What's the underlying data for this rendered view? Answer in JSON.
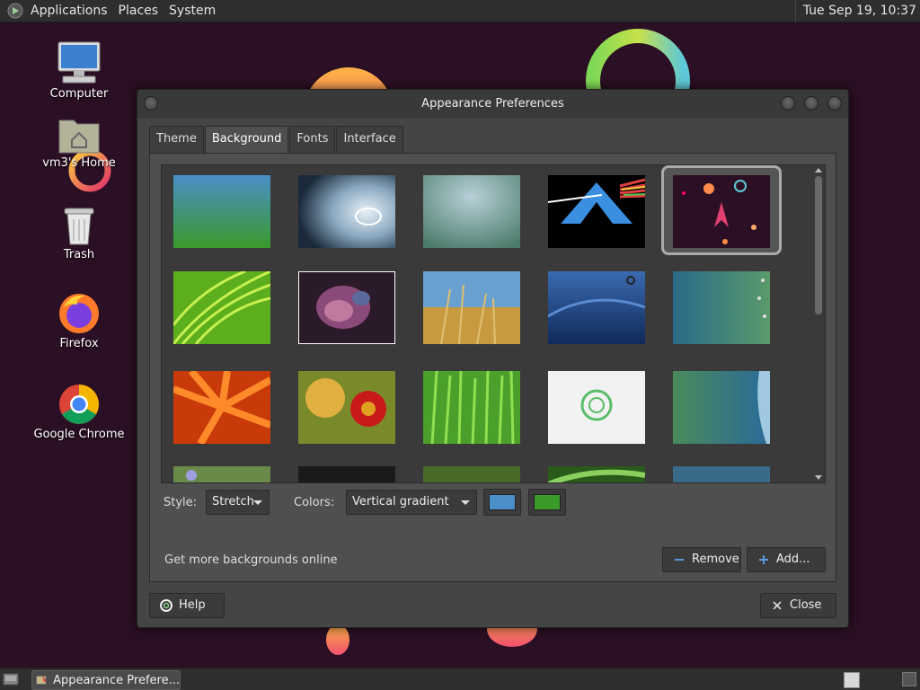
{
  "top_panel": {
    "menus": [
      "Applications",
      "Places",
      "System"
    ],
    "clock": "Tue Sep 19, 10:37"
  },
  "desktop_icons": [
    {
      "label": "Computer",
      "icon": "computer-icon"
    },
    {
      "label": "vm3's Home",
      "icon": "home-folder-icon"
    },
    {
      "label": "Trash",
      "icon": "trash-icon"
    },
    {
      "label": "Firefox",
      "icon": "firefox-icon"
    },
    {
      "label": "Google Chrome",
      "icon": "chrome-icon"
    }
  ],
  "window": {
    "title": "Appearance Preferences",
    "tabs": [
      "Theme",
      "Background",
      "Fonts",
      "Interface"
    ],
    "active_tab": "Background",
    "style_label": "Style:",
    "style_value": "Stretch",
    "colors_label": "Colors:",
    "colors_value": "Vertical gradient",
    "primary_color": "#4a8fc9",
    "secondary_color": "#3a9a2a",
    "get_more_link": "Get more backgrounds online",
    "remove_button": "Remove",
    "add_button": "Add...",
    "help_button": "Help",
    "close_button": "Close"
  },
  "taskbar": {
    "task_label": "Appearance Prefere..."
  }
}
